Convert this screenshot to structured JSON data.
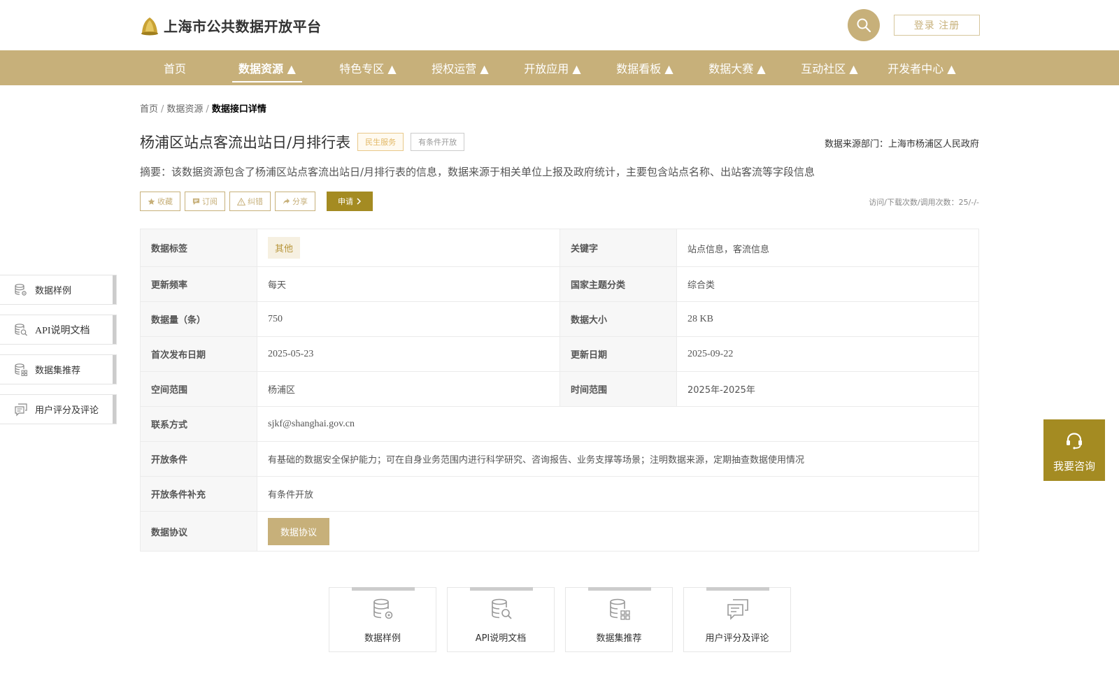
{
  "header": {
    "site_title": "上海市公共数据开放平台",
    "login_label": "登录 注册"
  },
  "nav": {
    "items": [
      {
        "label": "首页"
      },
      {
        "label": "数据资源 ▲"
      },
      {
        "label": "特色专区 ▲"
      },
      {
        "label": "授权运营 ▲"
      },
      {
        "label": "开放应用 ▲"
      },
      {
        "label": "数据看板 ▲"
      },
      {
        "label": "数据大赛 ▲"
      },
      {
        "label": "互动社区 ▲"
      },
      {
        "label": "开发者中心 ▲"
      }
    ],
    "active_index": 1
  },
  "breadcrumb": {
    "items": [
      "首页",
      "数据资源"
    ],
    "separator": "/",
    "current": "数据接口详情"
  },
  "dataset": {
    "title": "杨浦区站点客流出站日/月排行表",
    "tag_service": "民生服务",
    "tag_open": "有条件开放",
    "source_dept": "数据来源部门：上海市杨浦区人民政府",
    "summary": "摘要：该数据资源包含了杨浦区站点客流出站日/月排行表的信息，数据来源于相关单位上报及政府统计，主要包含站点名称、出站客流等字段信息",
    "visits": "访问/下载次数/调用次数：25/-/-"
  },
  "actions": {
    "collect": "收藏",
    "subscribe": "订阅",
    "report": "纠错",
    "share": "分享",
    "apply": "申请"
  },
  "table": {
    "data_tag_key": "数据标签",
    "data_tag_value": "其他",
    "keywords_key": "关键字",
    "keywords_value": "站点信息，客流信息",
    "frequency_key": "更新频率",
    "frequency_value": "每天",
    "theme_key": "国家主题分类",
    "theme_value": "综合类",
    "count_key": "数据量（条）",
    "count_value": "750",
    "size_key": "数据大小",
    "size_value": "28 KB",
    "first_pub_key": "首次发布日期",
    "first_pub_value": "2025-05-23",
    "update_key": "更新日期",
    "update_value": "2025-09-22",
    "space_key": "空间范围",
    "space_value": "杨浦区",
    "time_key": "时间范围",
    "time_value": "2025年-2025年",
    "contact_key": "联系方式",
    "contact_value": "sjkf@shanghai.gov.cn",
    "condition_key": "开放条件",
    "condition_value": "有基础的数据安全保护能力；可在自身业务范围内进行科学研究、咨询报告、业务支撑等场景；注明数据来源，定期抽查数据使用情况",
    "condition_extra_key": "开放条件补充",
    "condition_extra_value": "有条件开放",
    "agreement_key": "数据协议",
    "agreement_button": "数据协议"
  },
  "side_nav": {
    "items": [
      {
        "label": "数据样例",
        "icon": "database-gear-icon"
      },
      {
        "label": "API说明文档",
        "icon": "database-search-icon"
      },
      {
        "label": "数据集推荐",
        "icon": "database-grid-icon"
      },
      {
        "label": "用户评分及评论",
        "icon": "comments-icon"
      }
    ]
  },
  "cards": {
    "items": [
      {
        "label": "数据样例",
        "icon": "database-gear-icon"
      },
      {
        "label": "API说明文档",
        "icon": "database-search-icon"
      },
      {
        "label": "数据集推荐",
        "icon": "database-grid-icon"
      },
      {
        "label": "用户评分及评论",
        "icon": "comments-icon"
      }
    ]
  },
  "consult": {
    "label": "我要咨询",
    "icon": "headset-icon"
  },
  "colors": {
    "brand_gold": "#c7b07a",
    "apply_dark_gold": "#a48b22",
    "tag_orange": "#e2b865"
  }
}
